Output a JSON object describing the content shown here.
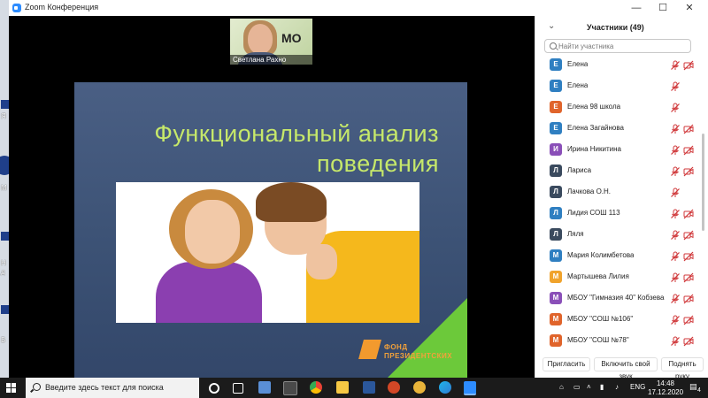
{
  "window": {
    "title": "Zoom Конференция",
    "minimize_glyph": "—",
    "maximize_glyph": "☐",
    "close_glyph": "✕"
  },
  "desktop": {
    "labels": [
      "Я",
      "М",
      "Н",
      "д",
      "В"
    ]
  },
  "speaker": {
    "name": "Светлана Рахно",
    "badge": "МО"
  },
  "slide": {
    "title_line1": "Функциональный анализ",
    "title_line2": "поведения",
    "logo_line1": "ФОНД",
    "logo_line2": "ПРЕЗИДЕНТСКИХ"
  },
  "participants": {
    "title": "Участники (49)",
    "search_placeholder": "Найти участника",
    "items": [
      {
        "initial": "Е",
        "name": "Елена",
        "color": "#2f7fc1",
        "mic_muted": true,
        "cam_off": true
      },
      {
        "initial": "Е",
        "name": "Елена",
        "color": "#2f7fc1",
        "mic_muted": true,
        "cam_off": false
      },
      {
        "initial": "Е",
        "name": "Елена 98 школа",
        "color": "#e0642b",
        "mic_muted": true,
        "cam_off": false
      },
      {
        "initial": "Е",
        "name": "Елена Загайнова",
        "color": "#2f7fc1",
        "mic_muted": true,
        "cam_off": true
      },
      {
        "initial": "И",
        "name": "Ирина Никитина",
        "color": "#8a4fb8",
        "mic_muted": true,
        "cam_off": true
      },
      {
        "initial": "Л",
        "name": "Лариса",
        "color": "#3a4a5e",
        "mic_muted": true,
        "cam_off": true
      },
      {
        "initial": "Л",
        "name": "Лачкова О.Н.",
        "color": "#3a4a5e",
        "mic_muted": true,
        "cam_off": false
      },
      {
        "initial": "Л",
        "name": "Лидия СОШ 113",
        "color": "#2f7fc1",
        "mic_muted": true,
        "cam_off": true
      },
      {
        "initial": "Л",
        "name": "Ляля",
        "color": "#3a4a5e",
        "mic_muted": true,
        "cam_off": true
      },
      {
        "initial": "М",
        "name": "Мария Колимбетова",
        "color": "#2f7fc1",
        "mic_muted": true,
        "cam_off": true
      },
      {
        "initial": "М",
        "name": "Мартышева Лилия",
        "color": "#f0a32c",
        "mic_muted": true,
        "cam_off": true
      },
      {
        "initial": "М",
        "name": "МБОУ \"Гимназия 40\" Кобзева ...",
        "color": "#8a4fb8",
        "mic_muted": true,
        "cam_off": true
      },
      {
        "initial": "М",
        "name": "МБОУ \"СОШ №106\"",
        "color": "#e0642b",
        "mic_muted": true,
        "cam_off": true
      },
      {
        "initial": "М",
        "name": "МБОУ \"СОШ №78\"",
        "color": "#e0642b",
        "mic_muted": true,
        "cam_off": true
      }
    ],
    "footer": {
      "invite": "Пригласить",
      "unmute_all": "Включить свой звук",
      "raise_hand": "Поднять руку"
    }
  },
  "taskbar": {
    "search_placeholder": "Введите здесь текст для поиска",
    "language": "ENG",
    "time": "14:48",
    "date": "17.12.2020",
    "notification_count": "4"
  },
  "colors": {
    "accent": "#2d8cff",
    "muted_red": "#d0393b",
    "slide_title": "#c6e86a"
  }
}
